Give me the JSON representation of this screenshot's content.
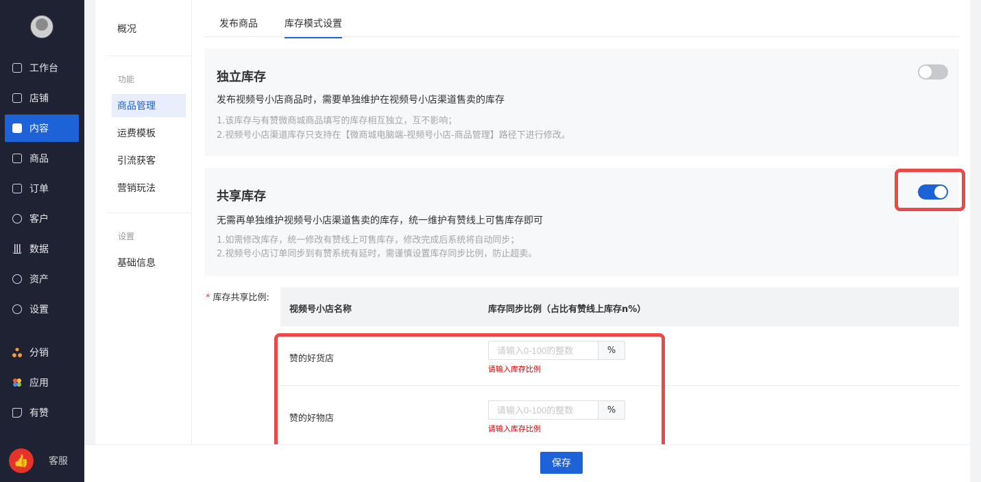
{
  "nav": {
    "items": [
      {
        "label": "工作台",
        "icon": "workbench-icon"
      },
      {
        "label": "店铺",
        "icon": "store-icon"
      },
      {
        "label": "内容",
        "icon": "content-icon"
      },
      {
        "label": "商品",
        "icon": "goods-icon"
      },
      {
        "label": "订单",
        "icon": "order-icon"
      },
      {
        "label": "客户",
        "icon": "customer-icon"
      },
      {
        "label": "数据",
        "icon": "data-icon"
      },
      {
        "label": "资产",
        "icon": "asset-icon"
      },
      {
        "label": "设置",
        "icon": "settings-icon"
      },
      {
        "label": "分销",
        "icon": "distribution-icon"
      },
      {
        "label": "应用",
        "icon": "apps-icon"
      },
      {
        "label": "有赞",
        "icon": "youzan-icon"
      }
    ],
    "active": "内容",
    "service_label": "客服"
  },
  "subnav": {
    "overview": "概况",
    "section_function": "功能",
    "items": [
      "商品管理",
      "运费模板",
      "引流获客",
      "营销玩法"
    ],
    "section_settings": "设置",
    "basic_info": "基础信息",
    "active": "商品管理"
  },
  "tabs": [
    "发布商品",
    "库存模式设置"
  ],
  "active_tab": "库存模式设置",
  "independent": {
    "title": "独立库存",
    "desc": "发布视频号小店商品时，需要单独维护在视频号小店渠道售卖的库存",
    "note1": "1.该库存与有赞微商城商品填写的库存相互独立，互不影响；",
    "note2": "2.视频号小店渠道库存只支持在【微商城电脑端-视频号小店-商品管理】路径下进行修改。",
    "enabled": false
  },
  "shared": {
    "title": "共享库存",
    "desc": "无需再单独维护视频号小店渠道售卖的库存，统一维护有赞线上可售库存即可",
    "note1": "1.如需修改库存，统一修改有赞线上可售库存，修改完成后系统将自动同步；",
    "note2": "2.视频号小店订单同步到有赞系统有延时，需谨慎设置库存同步比例，防止超卖。",
    "enabled": true
  },
  "ratio_form": {
    "required_mark": "*",
    "label": "库存共享比例:",
    "col_name": "视频号小店名称",
    "col_ratio": "库存同步比例（占比有赞线上库存n%）",
    "rows": [
      {
        "name": "赞的好货店",
        "placeholder": "请输入0-100的整数",
        "unit": "%",
        "error": "请输入库存比例"
      },
      {
        "name": "赞的好物店",
        "placeholder": "请输入0-100的整数",
        "unit": "%",
        "error": "请输入库存比例"
      }
    ]
  },
  "footer": {
    "save_label": "保存"
  },
  "colors": {
    "primary": "#1e62d8",
    "nav_bg": "#1f2233",
    "highlight": "#e84a4a",
    "error": "#d40000"
  }
}
